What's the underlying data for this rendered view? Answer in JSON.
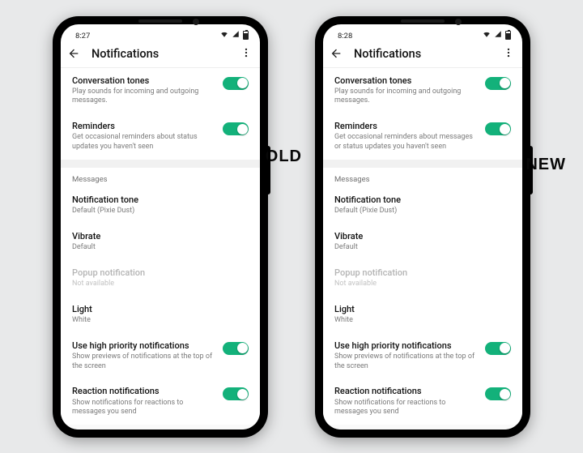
{
  "phones": [
    {
      "badge": "OLD",
      "status_time": "8:27",
      "title": "Notifications",
      "conversation_tones": {
        "title": "Conversation tones",
        "sub": "Play sounds for incoming and outgoing messages."
      },
      "reminders": {
        "title": "Reminders",
        "sub": "Get occasional reminders about status updates you haven't seen"
      },
      "section_messages": "Messages",
      "notification_tone": {
        "title": "Notification tone",
        "sub": "Default (Pixie Dust)"
      },
      "vibrate": {
        "title": "Vibrate",
        "sub": "Default"
      },
      "popup": {
        "title": "Popup notification",
        "sub": "Not available"
      },
      "light": {
        "title": "Light",
        "sub": "White"
      },
      "high_priority": {
        "title": "Use high priority notifications",
        "sub": "Show previews of notifications at the top of the screen"
      },
      "reaction": {
        "title": "Reaction notifications",
        "sub": "Show notifications for reactions to messages you send"
      }
    },
    {
      "badge": "NEW",
      "status_time": "8:28",
      "title": "Notifications",
      "conversation_tones": {
        "title": "Conversation tones",
        "sub": "Play sounds for incoming and outgoing messages."
      },
      "reminders": {
        "title": "Reminders",
        "sub": "Get occasional reminders about messages or status updates you haven't seen"
      },
      "section_messages": "Messages",
      "notification_tone": {
        "title": "Notification tone",
        "sub": "Default (Pixie Dust)"
      },
      "vibrate": {
        "title": "Vibrate",
        "sub": "Default"
      },
      "popup": {
        "title": "Popup notification",
        "sub": "Not available"
      },
      "light": {
        "title": "Light",
        "sub": "White"
      },
      "high_priority": {
        "title": "Use high priority notifications",
        "sub": "Show previews of notifications at the top of the screen"
      },
      "reaction": {
        "title": "Reaction notifications",
        "sub": "Show notifications for reactions to messages you send"
      }
    }
  ]
}
